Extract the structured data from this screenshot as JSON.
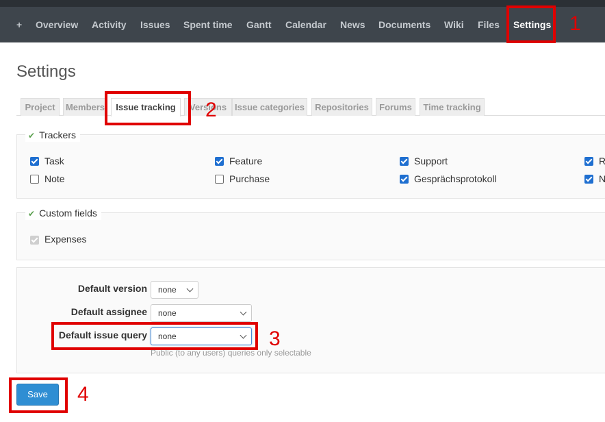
{
  "menu": {
    "plus": "+",
    "items": [
      "Overview",
      "Activity",
      "Issues",
      "Spent time",
      "Gantt",
      "Calendar",
      "News",
      "Documents",
      "Wiki",
      "Files",
      "Settings"
    ]
  },
  "page_title": "Settings",
  "tabs": [
    "Project",
    "Members",
    "Issue tracking",
    "Versions",
    "Issue categories",
    "Repositories",
    "Forums",
    "Time tracking"
  ],
  "selected_tab": "Issue tracking",
  "trackers": {
    "legend": "Trackers",
    "items": [
      {
        "label": "Task",
        "checked": true
      },
      {
        "label": "Feature",
        "checked": true
      },
      {
        "label": "Support",
        "checked": true
      },
      {
        "label": "R",
        "checked": true
      },
      {
        "label": "Note",
        "checked": false
      },
      {
        "label": "Purchase",
        "checked": false
      },
      {
        "label": "Gesprächsprotokoll",
        "checked": true
      },
      {
        "label": "N",
        "checked": true
      }
    ]
  },
  "custom_fields": {
    "legend": "Custom fields",
    "items": [
      {
        "label": "Expenses",
        "checked": true,
        "disabled": true
      }
    ]
  },
  "defaults": {
    "version_label": "Default version",
    "version_value": "none",
    "assignee_label": "Default assignee",
    "assignee_value": "none",
    "query_label": "Default issue query",
    "query_value": "none",
    "query_hint": "Public (to any users) queries only selectable"
  },
  "save_label": "Save",
  "annotations": [
    "1",
    "2",
    "3",
    "4"
  ],
  "colors": {
    "menu_bg": "#3e454c",
    "accent": "#2f8ed3",
    "checkbox": "#1f6fd0",
    "annotation": "#e00000",
    "legend_check": "#5ba04e"
  }
}
